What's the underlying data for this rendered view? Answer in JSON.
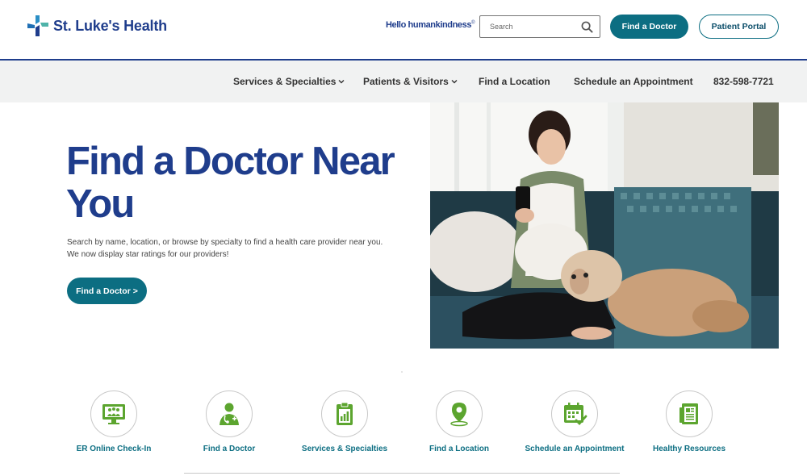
{
  "header": {
    "brand": "St. Luke's Health",
    "tagline": "Hello humankindness",
    "tagline_mark": "®",
    "search_placeholder": "Search",
    "find_doctor_label": "Find a Doctor",
    "patient_portal_label": "Patient Portal"
  },
  "nav": {
    "items": [
      {
        "label": "Services & Specialties",
        "dropdown": true
      },
      {
        "label": "Patients & Visitors",
        "dropdown": true
      },
      {
        "label": "Find a Location",
        "dropdown": false
      },
      {
        "label": "Schedule an Appointment",
        "dropdown": false
      },
      {
        "label": "832-598-7721",
        "dropdown": false
      }
    ]
  },
  "hero": {
    "title": "Find a Doctor Near You",
    "description_line1": "Search by name, location, or browse by specialty to find a health care provider near you.",
    "description_line2": "We now display star ratings for our providers!",
    "cta_label": "Find a Doctor >",
    "photo_icon": "woman-with-phone-and-dog-photo"
  },
  "quick_links": [
    {
      "label": "ER Online Check-In",
      "icon": "monitor-people-icon"
    },
    {
      "label": "Find a Doctor",
      "icon": "doctor-icon"
    },
    {
      "label": "Services & Specialties",
      "icon": "clipboard-chart-icon"
    },
    {
      "label": "Find a Location",
      "icon": "map-pin-icon"
    },
    {
      "label": "Schedule an Appointment",
      "icon": "calendar-check-icon"
    },
    {
      "label": "Healthy Resources",
      "icon": "document-list-icon"
    }
  ],
  "colors": {
    "brand_blue": "#1f3d8c",
    "teal": "#0c6e82",
    "icon_green": "#5ca52f",
    "nav_bg": "#f1f2f2"
  }
}
